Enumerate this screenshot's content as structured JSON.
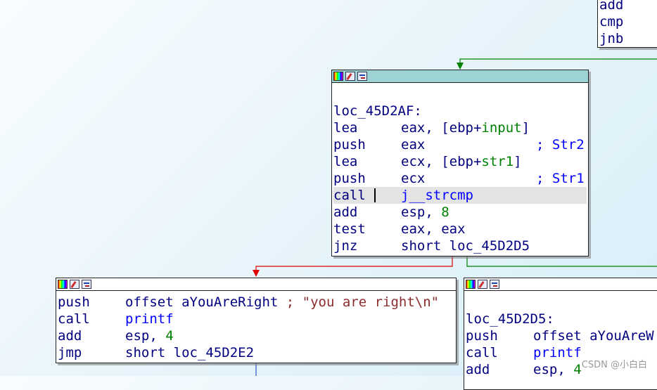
{
  "colors": {
    "edge_true": "#008000",
    "edge_false": "#e00000",
    "edge_jump": "#3355cc",
    "selected_header": "#9ed3d3"
  },
  "node_top_right": {
    "lines": [
      {
        "mnemonic": "add"
      },
      {
        "mnemonic": "cmp"
      },
      {
        "mnemonic": "jnb"
      }
    ]
  },
  "node_main": {
    "label": "loc_45D2AF:",
    "lines": [
      {
        "mnemonic": "lea",
        "operands": "eax, [ebp+",
        "var": "input",
        "after": "]"
      },
      {
        "mnemonic": "push",
        "operands": "eax",
        "comment": "; Str2"
      },
      {
        "mnemonic": "lea",
        "operands": "ecx, [ebp+",
        "var": "str1",
        "after": "]"
      },
      {
        "mnemonic": "push",
        "operands": "ecx",
        "comment": "; Str1"
      },
      {
        "mnemonic": "call",
        "func": "j__strcmp"
      },
      {
        "mnemonic": "add",
        "operands": "esp, ",
        "num": "8"
      },
      {
        "mnemonic": "test",
        "operands": "eax, eax"
      },
      {
        "mnemonic": "jnz",
        "operands": "short loc_45D2D5"
      }
    ]
  },
  "node_left": {
    "lines": [
      {
        "mnemonic": "push",
        "operands": "offset aYouAreRight ",
        "string": "; \"you are right\\n\""
      },
      {
        "mnemonic": "call",
        "func": "printf"
      },
      {
        "mnemonic": "add",
        "operands": "esp, ",
        "num": "4"
      },
      {
        "mnemonic": "jmp",
        "operands": "short loc_45D2E2"
      }
    ]
  },
  "node_right": {
    "label": "loc_45D2D5:",
    "lines": [
      {
        "mnemonic": "push",
        "operands": "offset aYouAreW"
      },
      {
        "mnemonic": "call",
        "func": "printf"
      },
      {
        "mnemonic": "add",
        "operands": "esp, ",
        "num": "4"
      }
    ]
  },
  "watermark": "CSDN @小白白"
}
